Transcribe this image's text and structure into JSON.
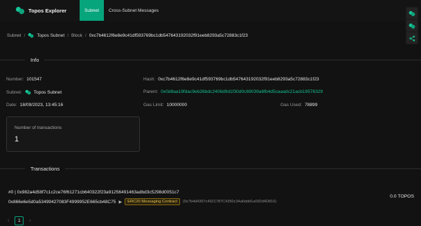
{
  "header": {
    "app_title": "Topos Explorer",
    "tabs": [
      {
        "label": "Subnet",
        "active": true
      },
      {
        "label": "Cross-Subnet Messages",
        "active": false
      }
    ],
    "accent_color": "#06a57c"
  },
  "side_tools": {
    "icons": [
      "topos-logo-icon",
      "topos-logo-icon",
      "share-network-icon"
    ]
  },
  "breadcrumb": {
    "root": "Subnet",
    "subnet": "Topos Subnet",
    "section": "Block",
    "current": "0xc7b4612f6e8e9c41df593769bc1db547643192032f91eeb8293a5c72883c1f23"
  },
  "info": {
    "title": "Info",
    "number_label": "Number:",
    "number": "101547",
    "subnet_label": "Subnet:",
    "subnet": "Topos Subnet",
    "date_label": "Date:",
    "date": "18/09/2023, 13:45:16",
    "hash_label": "Hash:",
    "hash": "0xc7b4612f6e8e9c41df593769bc1db547643192032f91eeb8293a5c72883c1f23",
    "parent_label": "Parent:",
    "parent": "0x0d8aa19fdac9eb26bdc2406d9d1f30d0c69039a6fb4d5caaadc21acb19576329",
    "gas_limit_label": "Gas Limit:",
    "gas_limit": "10000000",
    "gas_used_label": "Gas Used:",
    "gas_used": "78899"
  },
  "tx_count": {
    "label": "Number of transactions",
    "value": "1"
  },
  "transactions": {
    "title": "Transactions",
    "rows": [
      {
        "index_hash": "#0 | 0x982a4d58f7c1c2ce76f61271cb640322f23a91256491463adbd3c5298d0051c7",
        "from": "0x866e6e5d0a53499427083F4999952E665cb48C75",
        "arrow": "▶",
        "to_badge": "ERC20 Messaging Contract",
        "to_address": "(0x7b4d4397c4921787C4350c34a6ddd1a092d4D816)",
        "amount": "0.0 TOPOS"
      }
    ]
  },
  "pagination": {
    "prev": "‹",
    "page": "1",
    "next": "›"
  }
}
